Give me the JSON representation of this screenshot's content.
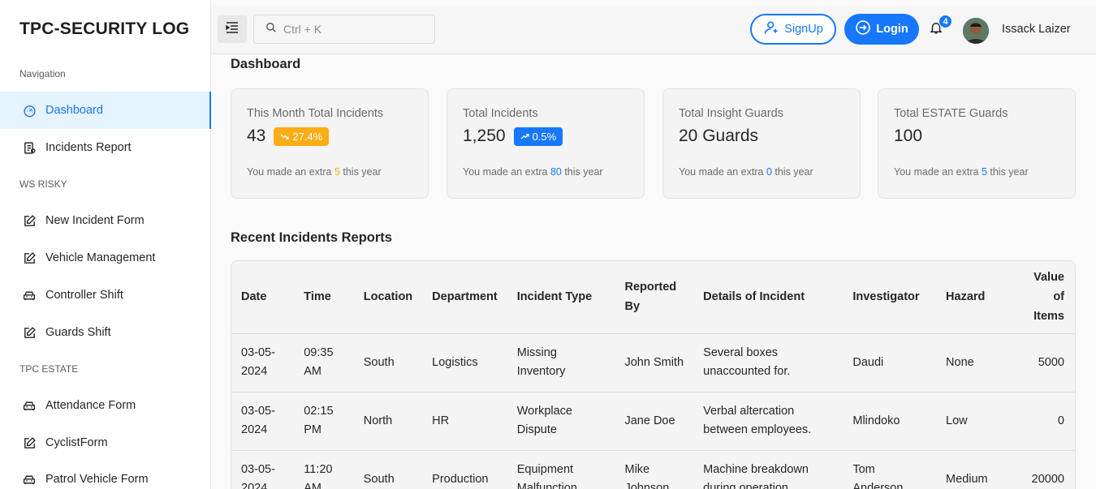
{
  "sidebar": {
    "brand": "TPC-SECURITY LOG",
    "sections": [
      {
        "caption": "Navigation"
      },
      {
        "caption": "WS RISKY"
      },
      {
        "caption": "TPC ESTATE"
      }
    ],
    "items": [
      {
        "label": "Dashboard",
        "icon": "dashboard-icon",
        "active": true
      },
      {
        "label": "Incidents Report",
        "icon": "report-icon"
      },
      {
        "label": "New Incident Form",
        "icon": "edit-icon"
      },
      {
        "label": "Vehicle Management",
        "icon": "edit-icon"
      },
      {
        "label": "Controller Shift",
        "icon": "car-icon"
      },
      {
        "label": "Guards Shift",
        "icon": "edit-icon"
      },
      {
        "label": "Attendance Form",
        "icon": "car-icon"
      },
      {
        "label": "CyclistForm",
        "icon": "edit-icon"
      },
      {
        "label": "Patrol Vehicle Form",
        "icon": "car-icon"
      }
    ]
  },
  "header": {
    "search_placeholder": "Ctrl + K",
    "signup_label": "SignUp",
    "login_label": "Login",
    "notification_count": "4",
    "user_name": "Issack Laizer"
  },
  "dashboard": {
    "title": "Dashboard",
    "cards": [
      {
        "label": "This Month Total Incidents",
        "value": "43",
        "chip": "27.4%",
        "chip_type": "warn",
        "foot_pre": "You made an extra ",
        "foot_num": "5",
        "foot_post": " this year"
      },
      {
        "label": "Total Incidents",
        "value": "1,250",
        "chip": "0.5%",
        "chip_type": "up",
        "foot_pre": "You made an extra ",
        "foot_num": "80",
        "foot_post": " this year"
      },
      {
        "label": "Total Insight Guards",
        "value": "20 Guards",
        "foot_pre": "You made an extra ",
        "foot_num": "0",
        "foot_post": " this year"
      },
      {
        "label": "Total ESTATE Guards",
        "value": "100",
        "foot_pre": "You made an extra ",
        "foot_num": "5",
        "foot_post": " this year"
      }
    ]
  },
  "recent": {
    "title": "Recent Incidents Reports",
    "columns": [
      "Date",
      "Time",
      "Location",
      "Department",
      "Incident Type",
      "Reported By",
      "Details of Incident",
      "Investigator",
      "Hazard",
      "Value of Items"
    ],
    "rows": [
      [
        "03-05-2024",
        "09:35 AM",
        "South",
        "Logistics",
        "Missing Inventory",
        "John Smith",
        "Several boxes unaccounted for.",
        "Daudi",
        "None",
        "5000"
      ],
      [
        "03-05-2024",
        "02:15 PM",
        "North",
        "HR",
        "Workplace Dispute",
        "Jane Doe",
        "Verbal altercation between employees.",
        "Mlindoko",
        "Low",
        "0"
      ],
      [
        "03-05-2024",
        "11:20 AM",
        "South",
        "Production",
        "Equipment Malfunction",
        "Mike Johnson",
        "Machine breakdown during operation",
        "Tom Anderson",
        "Medium",
        "20000"
      ]
    ]
  },
  "colors": {
    "accent": "#1677ff",
    "warning": "#faad14",
    "active_bg": "#e6f4ff"
  }
}
